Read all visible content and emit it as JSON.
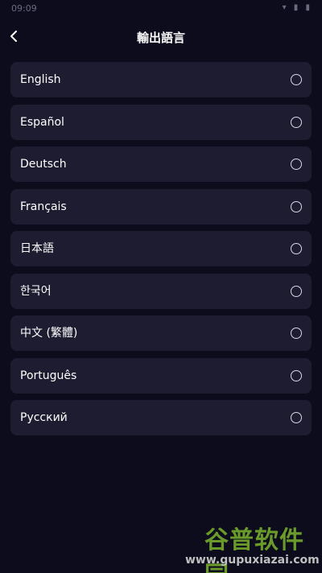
{
  "status_bar": {
    "time": "09:09",
    "icons": "▾ ▮ ▮"
  },
  "header": {
    "title": "輸出語言"
  },
  "languages": [
    {
      "label": "English"
    },
    {
      "label": "Español"
    },
    {
      "label": "Deutsch"
    },
    {
      "label": "Français"
    },
    {
      "label": "日本語"
    },
    {
      "label": "한국어"
    },
    {
      "label": "中文 (繁體)"
    },
    {
      "label": "Português"
    },
    {
      "label": "Русский"
    }
  ],
  "watermark": {
    "title": "谷普软件园",
    "url": "www.gupuxiazai.com"
  },
  "colors": {
    "background": "#0d0c1d",
    "item_background": "#1e1c30",
    "text": "#ffffff",
    "watermark_green": "#6a9b2a"
  }
}
